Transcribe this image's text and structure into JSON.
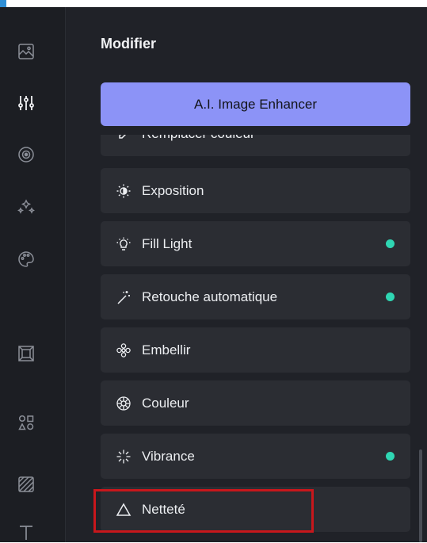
{
  "panel": {
    "title": "Modifier",
    "enhance_button": "A.I. Image Enhancer",
    "partial_item": "Remplacer couleur",
    "items": [
      {
        "label": "Exposition",
        "icon": "sun-icon",
        "active": false
      },
      {
        "label": "Fill Light",
        "icon": "bulb-icon",
        "active": true
      },
      {
        "label": "Retouche automatique",
        "icon": "magic-wand-icon",
        "active": true
      },
      {
        "label": "Embellir",
        "icon": "flower-icon",
        "active": false
      },
      {
        "label": "Couleur",
        "icon": "color-wheel-icon",
        "active": false
      },
      {
        "label": "Vibrance",
        "icon": "sparkle-icon",
        "active": true
      },
      {
        "label": "Netteté",
        "icon": "triangle-icon",
        "active": false
      }
    ]
  },
  "sidebar": {
    "icons": [
      "image-icon",
      "sliders-icon",
      "eye-icon",
      "sparkles-icon",
      "palette-icon",
      "frame-icon",
      "shapes-icon",
      "texture-icon",
      "text-icon"
    ]
  },
  "colors": {
    "accent": "#8c93f7",
    "active_dot": "#2fd6b3",
    "highlight": "#c8171c"
  }
}
